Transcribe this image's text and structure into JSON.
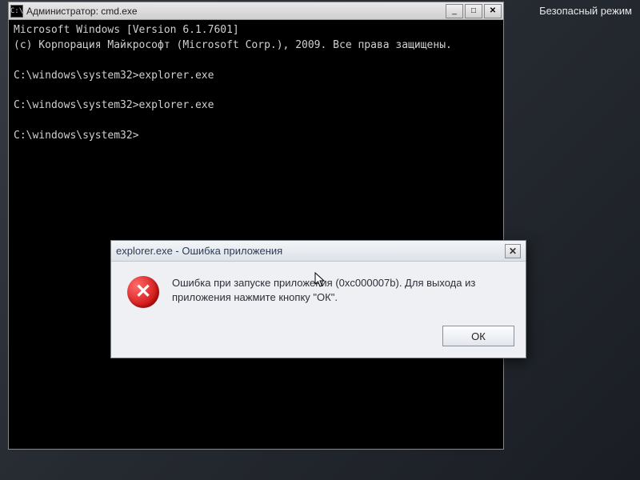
{
  "desktop": {
    "safe_mode_label": "Безопасный режим"
  },
  "cmd": {
    "title": "Администратор: cmd.exe",
    "icon_glyph": "C:\\",
    "lines": [
      "Microsoft Windows [Version 6.1.7601]",
      "(c) Корпорация Майкрософт (Microsoft Corp.), 2009. Все права защищены.",
      "",
      "C:\\windows\\system32>explorer.exe",
      "",
      "C:\\windows\\system32>explorer.exe",
      "",
      "C:\\windows\\system32>"
    ],
    "buttons": {
      "minimize": "_",
      "maximize": "□",
      "close": "✕"
    }
  },
  "dialog": {
    "title": "explorer.exe - Ошибка приложения",
    "close_glyph": "✕",
    "icon_glyph": "✕",
    "message": "Ошибка при запуске приложения (0xc000007b). Для выхода из приложения нажмите кнопку \"ОК\".",
    "ok_label": "ОК"
  }
}
